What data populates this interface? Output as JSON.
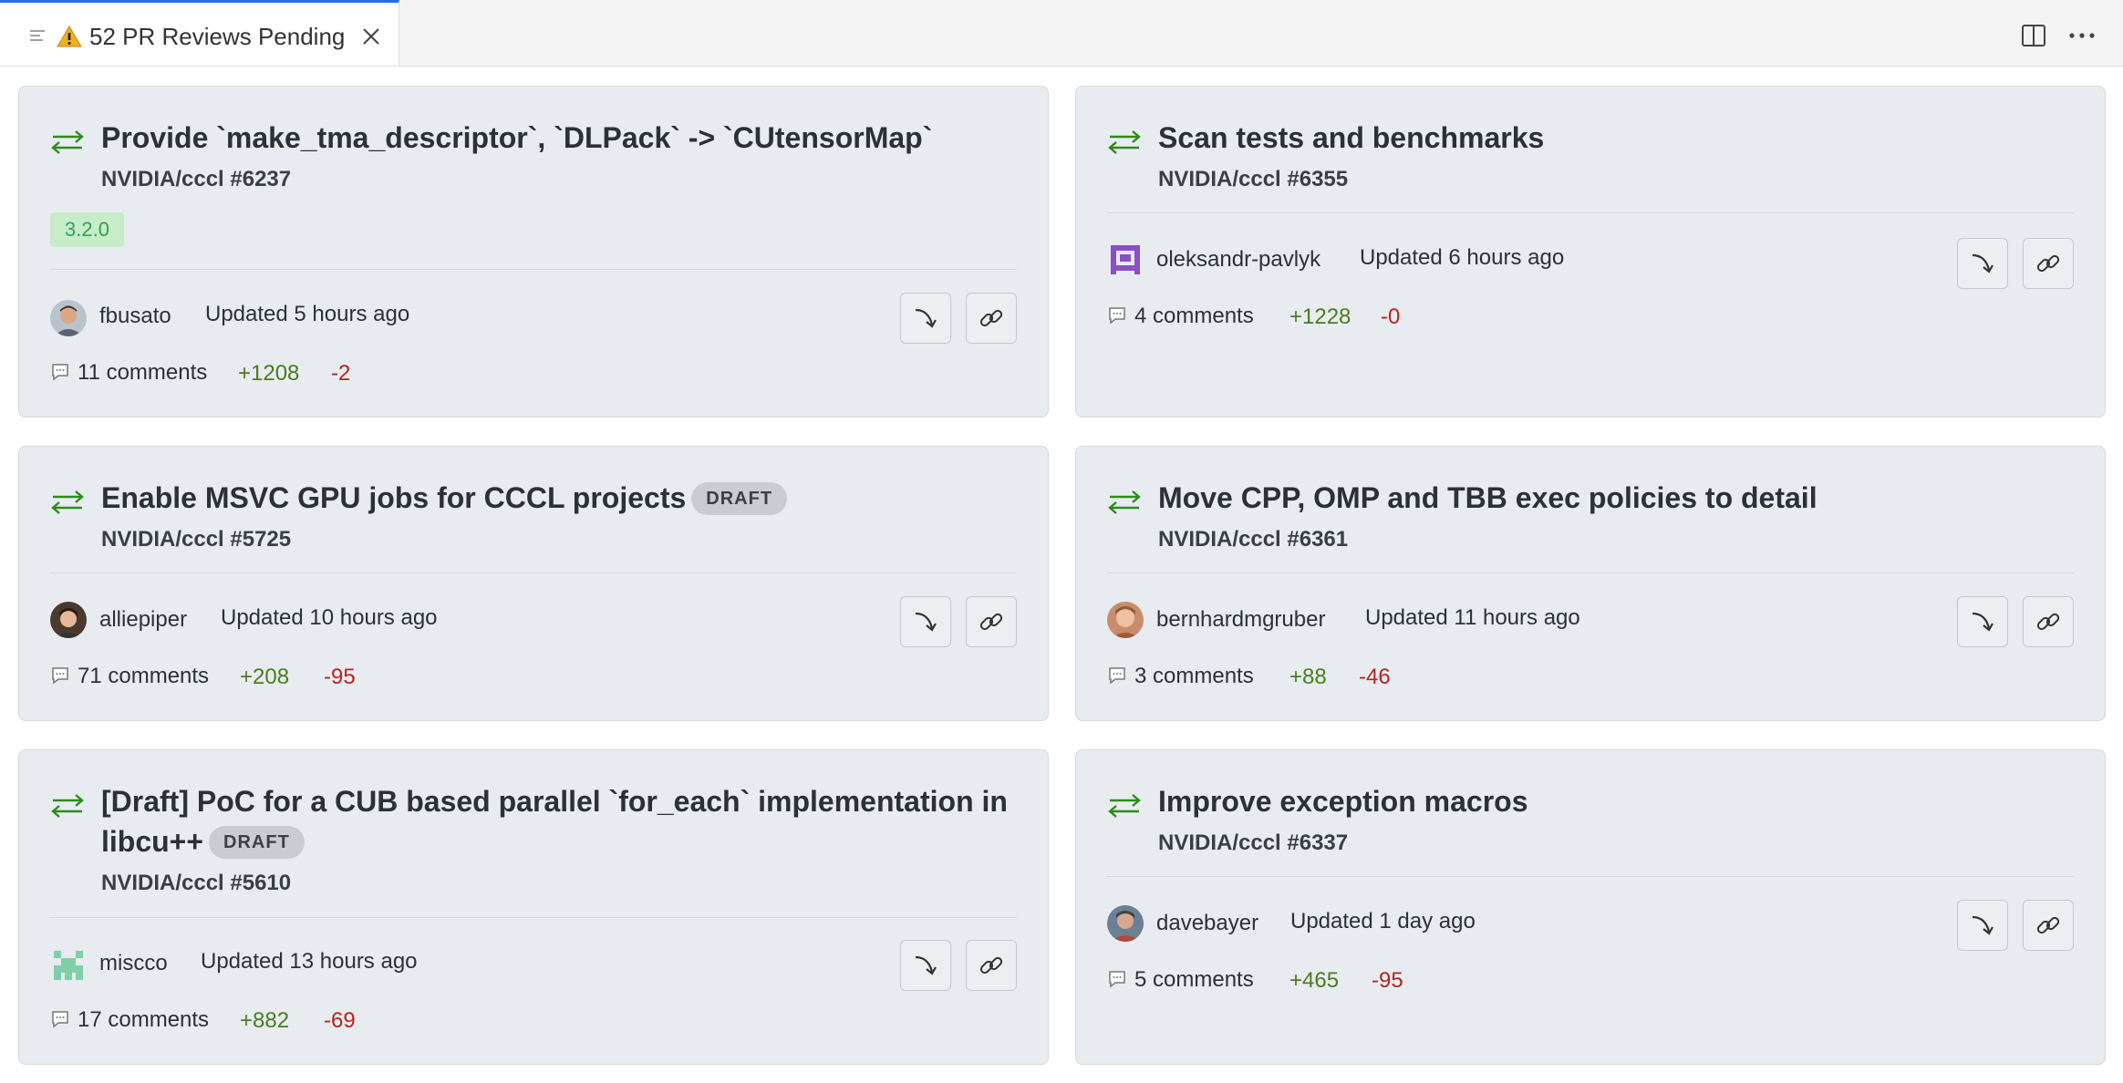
{
  "tab": {
    "title": "52 PR Reviews Pending"
  },
  "cards": [
    {
      "title": "Provide `make_tma_descriptor`, `DLPack` -> `CUtensorMap`",
      "repo": "NVIDIA/cccl #6237",
      "label": "3.2.0",
      "author": "fbusato",
      "updated": "Updated 5 hours ago",
      "comments": "11 comments",
      "additions": "+1208",
      "deletions": "-2"
    },
    {
      "title": "Scan tests and benchmarks",
      "repo": "NVIDIA/cccl #6355",
      "author": "oleksandr-pavlyk",
      "updated": "Updated 6 hours ago",
      "comments": "4 comments",
      "additions": "+1228",
      "deletions": "-0"
    },
    {
      "title": "Enable MSVC GPU jobs for CCCL projects",
      "draft": "DRAFT",
      "repo": "NVIDIA/cccl #5725",
      "author": "alliepiper",
      "updated": "Updated 10 hours ago",
      "comments": "71 comments",
      "additions": "+208",
      "deletions": "-95"
    },
    {
      "title": "Move CPP, OMP and TBB exec policies to detail",
      "repo": "NVIDIA/cccl #6361",
      "author": "bernhardmgruber",
      "updated": "Updated 11 hours ago",
      "comments": "3 comments",
      "additions": "+88",
      "deletions": "-46"
    },
    {
      "title_line1": "[Draft] PoC for a CUB based parallel `for_each` implementation in",
      "title_line2": "libcu++",
      "draft": "DRAFT",
      "repo": "NVIDIA/cccl #5610",
      "author": "miscco",
      "updated": "Updated 13 hours ago",
      "comments": "17 comments",
      "additions": "+882",
      "deletions": "-69"
    },
    {
      "title": "Improve exception macros",
      "repo": "NVIDIA/cccl #6337",
      "author": "davebayer",
      "updated": "Updated 1 day ago",
      "comments": "5 comments",
      "additions": "+465",
      "deletions": "-95"
    }
  ]
}
